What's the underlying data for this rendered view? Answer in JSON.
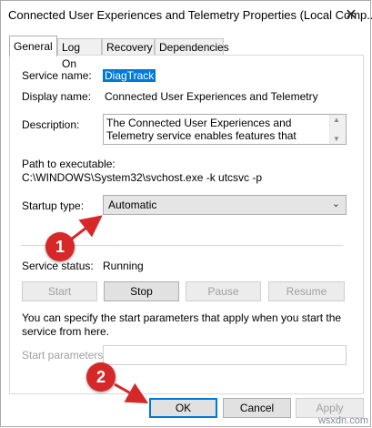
{
  "window": {
    "title": "Connected User Experiences and Telemetry Properties (Local Comp..."
  },
  "tabs": [
    {
      "label": "General",
      "active": true
    },
    {
      "label": "Log On",
      "active": false
    },
    {
      "label": "Recovery",
      "active": false
    },
    {
      "label": "Dependencies",
      "active": false
    }
  ],
  "general": {
    "service_name_label": "Service name:",
    "service_name": "DiagTrack",
    "display_name_label": "Display name:",
    "display_name": "Connected User Experiences and Telemetry",
    "description_label": "Description:",
    "description": "The Connected User Experiences and Telemetry service enables features that support in-application",
    "path_label": "Path to executable:",
    "path": "C:\\WINDOWS\\System32\\svchost.exe -k utcsvc -p",
    "startup_label": "Startup type:",
    "startup_value": "Automatic",
    "status_label": "Service status:",
    "status_value": "Running"
  },
  "service_buttons": {
    "start": "Start",
    "stop": "Stop",
    "pause": "Pause",
    "resume": "Resume"
  },
  "start_params": {
    "hint": "You can specify the start parameters that apply when you start the service from here.",
    "label": "Start parameters:",
    "value": ""
  },
  "dialog_buttons": {
    "ok": "OK",
    "cancel": "Cancel",
    "apply": "Apply"
  },
  "annotations": [
    {
      "number": "1"
    },
    {
      "number": "2"
    }
  ],
  "colors": {
    "selection": "#0078d7",
    "annotation_red": "#d62828"
  },
  "watermark": "wsxdn.com"
}
